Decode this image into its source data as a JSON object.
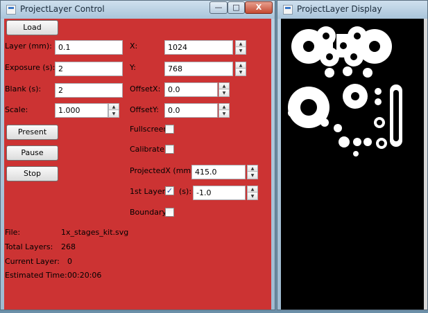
{
  "control_window": {
    "title": "ProjectLayer Control",
    "buttons": {
      "load": "Load",
      "present": "Present",
      "pause": "Pause",
      "stop": "Stop"
    },
    "fields": {
      "layer_label": "Layer (mm):",
      "layer_value": "0.1",
      "exposure_label": "Exposure (s):",
      "exposure_value": "2",
      "blank_label": "Blank (s):",
      "blank_value": "2",
      "scale_label": "Scale:",
      "scale_value": "1.000",
      "x_label": "X:",
      "x_value": "1024",
      "y_label": "Y:",
      "y_value": "768",
      "offsetx_label": "OffsetX:",
      "offsetx_value": "0.0",
      "offsety_label": "OffsetY:",
      "offsety_value": "0.0",
      "fullscreen_label": "Fullscreen:",
      "fullscreen_checked": false,
      "calibrate_label": "Calibrate:",
      "calibrate_checked": false,
      "projectedx_label": "ProjectedX (mm):",
      "projectedx_value": "415.0",
      "firstlayer_label": "1st Layer:",
      "firstlayer_checked": true,
      "firstlayer_unit": "(s):",
      "firstlayer_value": "-1.0",
      "boundary_label": "Boundary:",
      "boundary_checked": false
    },
    "info": {
      "file_label": "File:",
      "file_value": "1x_stages_kit.svg",
      "total_label": "Total Layers:",
      "total_value": "268",
      "current_label": "Current Layer:",
      "current_value": "0",
      "time_label": "Estimated Time:",
      "time_value": "00:20:06"
    }
  },
  "display_window": {
    "title": "ProjectLayer Display"
  },
  "caption_buttons": {
    "minimize": "—",
    "maximize": "□",
    "close": "X"
  },
  "spin_glyphs": {
    "up": "▲",
    "down": "▼"
  },
  "check_glyph": "✓",
  "colors": {
    "control_client": "#cc3333",
    "display_client": "#000000",
    "drawing": "#ffffff"
  }
}
